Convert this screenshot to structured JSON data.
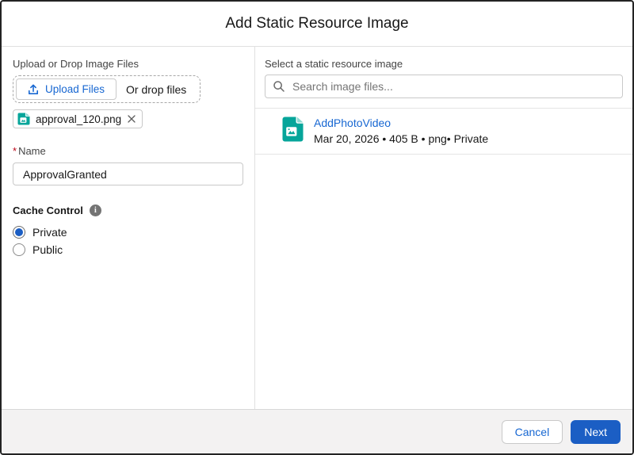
{
  "dialog": {
    "title": "Add Static Resource Image"
  },
  "left_panel": {
    "upload_label": "Upload or Drop Image Files",
    "upload_button_label": "Upload Files",
    "drop_text": "Or drop files",
    "file_chip": {
      "name": "approval_120.png",
      "icon": "image-file-icon",
      "remove_icon": "close-icon"
    },
    "name_field": {
      "required_marker": "*",
      "label": "Name",
      "value": "ApprovalGranted"
    },
    "cache_control": {
      "label": "Cache Control",
      "info_icon": "info-icon",
      "options": [
        {
          "label": "Private",
          "selected": true
        },
        {
          "label": "Public",
          "selected": false
        }
      ]
    }
  },
  "right_panel": {
    "label": "Select a static resource image",
    "search": {
      "icon": "search-icon",
      "placeholder": "Search image files..."
    },
    "files": [
      {
        "icon": "image-file-icon",
        "title": "AddPhotoVideo",
        "meta": "Mar 20, 2026 • 405 B • png• Private"
      }
    ]
  },
  "footer": {
    "cancel_label": "Cancel",
    "next_label": "Next"
  },
  "icons": {
    "upload-icon": "arrow up into tray",
    "close-icon": "✕",
    "search-icon": "magnifier",
    "info-icon": "i in filled circle",
    "image-file-icon": "teal file with picture glyph"
  },
  "colors": {
    "accent_blue": "#1B5EC4",
    "link_blue": "#1767D2",
    "teal_icon": "#06A59A",
    "teal_icon_fold": "#8ED9D3",
    "required_red": "#BA0517",
    "footer_bg": "#F3F2F2",
    "border_gray": "#C9C9C9"
  }
}
